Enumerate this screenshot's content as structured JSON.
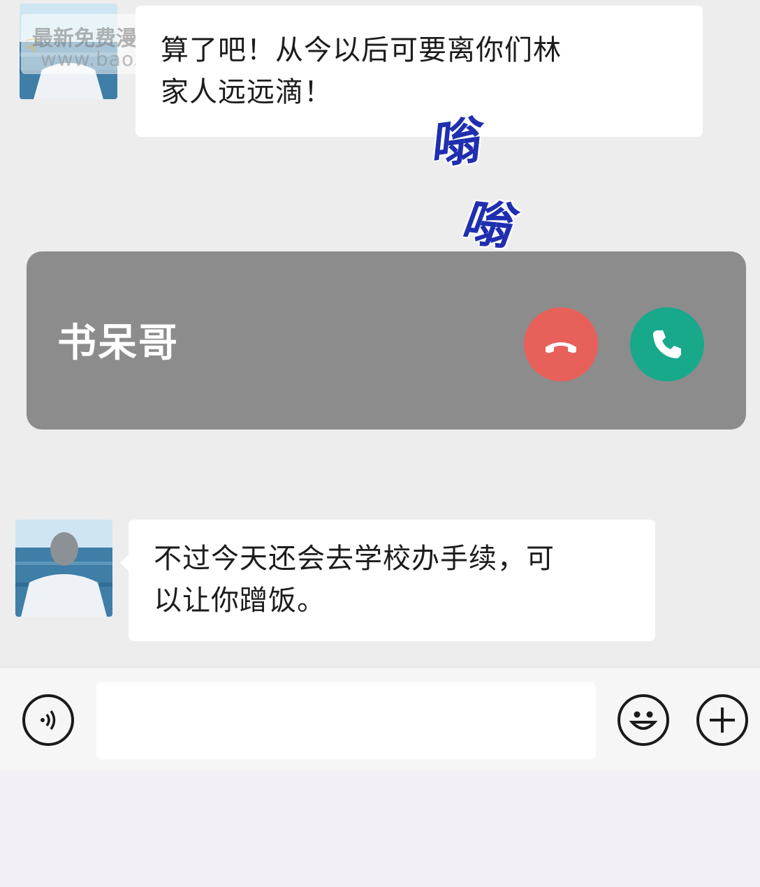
{
  "watermark": {
    "title": "最新免费漫画",
    "url": "www.baozimh.com"
  },
  "messages": [
    {
      "lines": [
        "算了吧！从今以后可要离你们林",
        "家人远远滴！"
      ]
    },
    {
      "lines": [
        "不过今天还会去学校办手续，可",
        "以让你蹭饭。"
      ]
    }
  ],
  "sound_effect": {
    "first": "嗡",
    "second": "嗡"
  },
  "incoming_call": {
    "caller_name": "书呆哥",
    "decline_icon": "phone-hangup-icon",
    "accept_icon": "phone-icon",
    "decline_color": "#e8605a",
    "accept_color": "#18a98b"
  },
  "input_bar": {
    "voice_icon": "voice-icon",
    "emoji_icon": "smiley-icon",
    "more_icon": "plus-icon",
    "text_value": ""
  }
}
